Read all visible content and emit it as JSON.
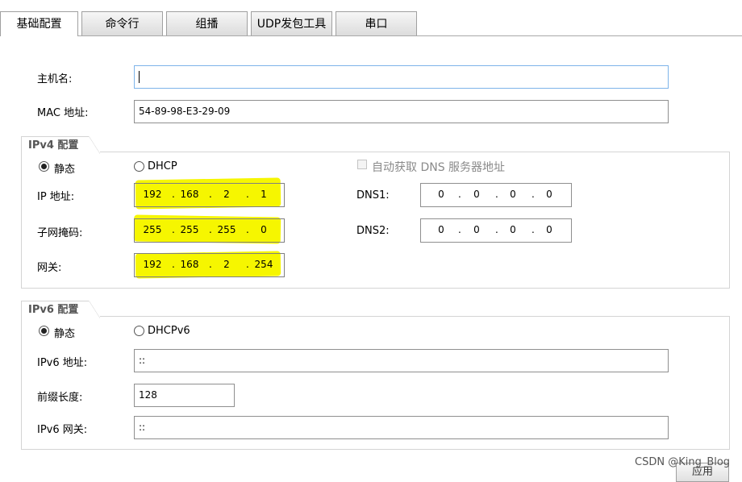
{
  "tabs": [
    "基础配置",
    "命令行",
    "组播",
    "UDP发包工具",
    "串口"
  ],
  "basic": {
    "hostname_label": "主机名:",
    "hostname_value": "",
    "mac_label": "MAC 地址:",
    "mac_value": "54-89-98-E3-29-09"
  },
  "ipv4": {
    "title": "IPv4 配置",
    "static_label": "静态",
    "dhcp_label": "DHCP",
    "auto_dns_label": "自动获取 DNS 服务器地址",
    "ip_label": "IP 地址:",
    "ip": [
      "192",
      "168",
      "2",
      "1"
    ],
    "mask_label": "子网掩码:",
    "mask": [
      "255",
      "255",
      "255",
      "0"
    ],
    "gateway_label": "网关:",
    "gateway": [
      "192",
      "168",
      "2",
      "254"
    ],
    "dns1_label": "DNS1:",
    "dns1": [
      "0",
      "0",
      "0",
      "0"
    ],
    "dns2_label": "DNS2:",
    "dns2": [
      "0",
      "0",
      "0",
      "0"
    ]
  },
  "ipv6": {
    "title": "IPv6 配置",
    "static_label": "静态",
    "dhcp_label": "DHCPv6",
    "addr_label": "IPv6 地址:",
    "addr_value": "::",
    "prefix_label": "前缀长度:",
    "prefix_value": "128",
    "gateway_label": "IPv6 网关:",
    "gateway_value": "::"
  },
  "apply_label": "应用",
  "watermark": "CSDN @King_Blog",
  "colors": {
    "highlight": "#f6f600",
    "focus_border": "#7eb4ea"
  }
}
